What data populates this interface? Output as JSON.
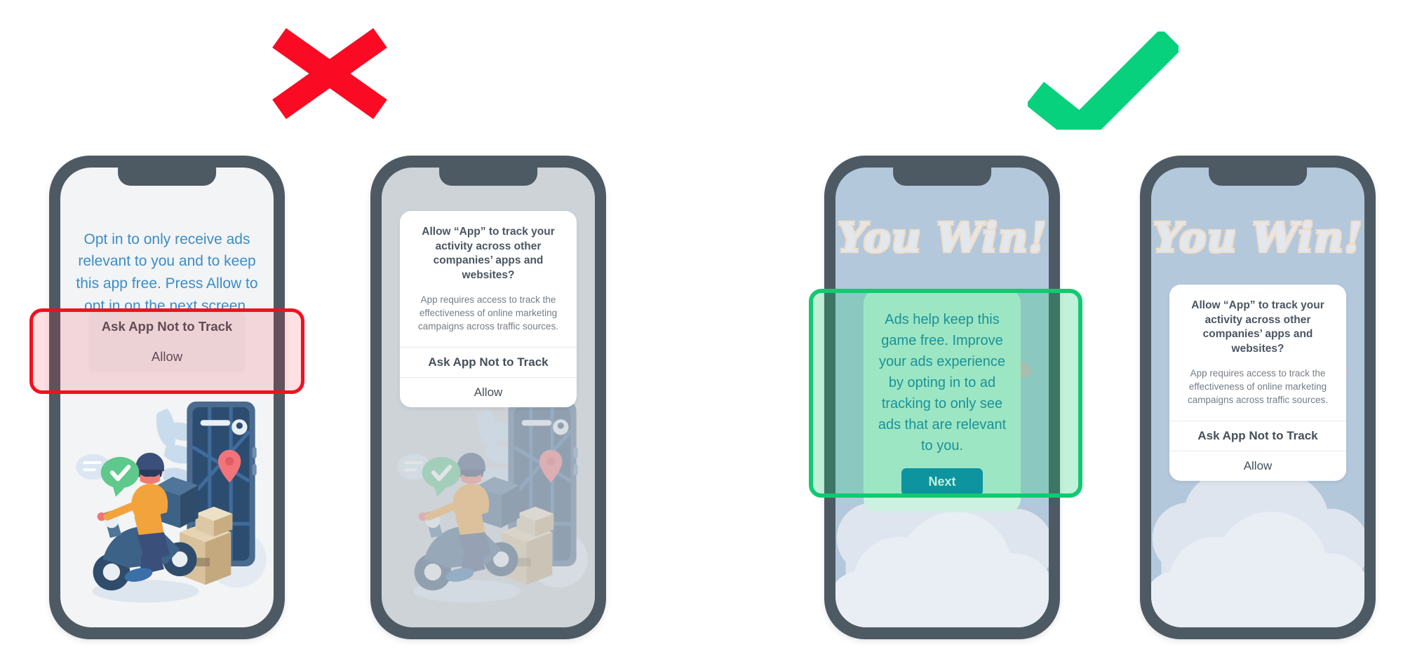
{
  "marks": {
    "bad": {
      "name": "red-x-mark",
      "color": "#fa0a23"
    },
    "good": {
      "name": "green-check-mark",
      "color": "#08d17e"
    }
  },
  "phones": {
    "one": {
      "label": "bad-example-pre-prompt",
      "headline": "Opt in to only receive ads relevant to you and to keep this app free. Press Allow to opt in on the next screen.",
      "option_primary": "Ask App Not to Track",
      "option_secondary": "Allow",
      "highlight_color": "#f50f1e"
    },
    "two": {
      "label": "bad-example-att-dialog",
      "att": {
        "title": "Allow “App” to track your activity across other companies’ apps and websites?",
        "description": "App requires access to track the effectiveness of online marketing campaigns across traffic sources.",
        "deny_label": "Ask App Not to Track",
        "allow_label": "Allow"
      }
    },
    "three": {
      "label": "good-example-pre-prompt",
      "game_title": "You Win!",
      "prompt_text": "Ads help keep this game free. Improve your ads experience by opting in to ad tracking to only see ads that are relevant to you.",
      "next_label": "Next",
      "highlight_color": "#12c971"
    },
    "four": {
      "label": "good-example-att-dialog",
      "game_title": "You Win!",
      "att": {
        "title": "Allow “App” to track your activity across other companies’ apps and websites?",
        "description": "App requires access to track the effectiveness of online marketing campaigns across traffic sources.",
        "deny_label": "Ask App Not to Track",
        "allow_label": "Allow"
      }
    }
  }
}
